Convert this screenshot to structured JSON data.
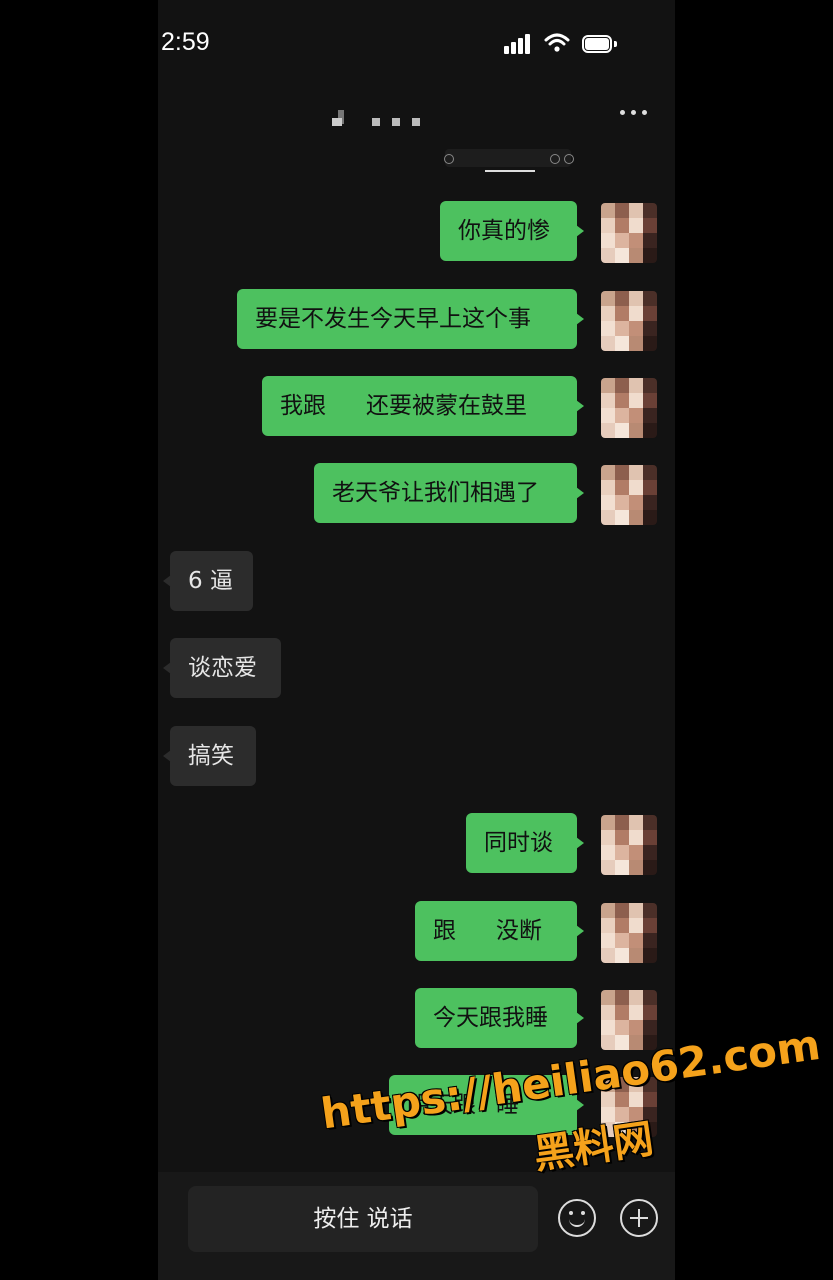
{
  "status_bar": {
    "time": "2:59"
  },
  "messages": [
    {
      "side": "out",
      "text": "你真的惨"
    },
    {
      "side": "out",
      "text": "要是不发生今天早上这个事"
    },
    {
      "side": "out",
      "text_before": "我跟",
      "text_after": "还要被蒙在鼓里"
    },
    {
      "side": "out",
      "text": "老天爷让我们相遇了"
    },
    {
      "side": "in",
      "text": "6 逼"
    },
    {
      "side": "in",
      "text": "谈恋爱"
    },
    {
      "side": "in",
      "text": "搞笑"
    },
    {
      "side": "out",
      "text": "同时谈"
    },
    {
      "side": "out",
      "text_before": "跟",
      "text_after": "没断"
    },
    {
      "side": "out",
      "text": "今天跟我睡"
    },
    {
      "side": "out",
      "text_before": "明天跟",
      "text_after": "睡"
    }
  ],
  "input_bar": {
    "hold_to_talk_label": "按住 说话"
  },
  "watermark": {
    "url": "https://heiliao62.com",
    "name": "黑料网",
    "color": "#f5a21b"
  },
  "colors": {
    "outgoing_bubble": "#4dc15f",
    "incoming_bubble": "#2c2c2c",
    "background": "#121212"
  },
  "icons": [
    "signal-icon",
    "wifi-icon",
    "battery-icon",
    "more-icon",
    "emoji-icon",
    "plus-icon"
  ]
}
